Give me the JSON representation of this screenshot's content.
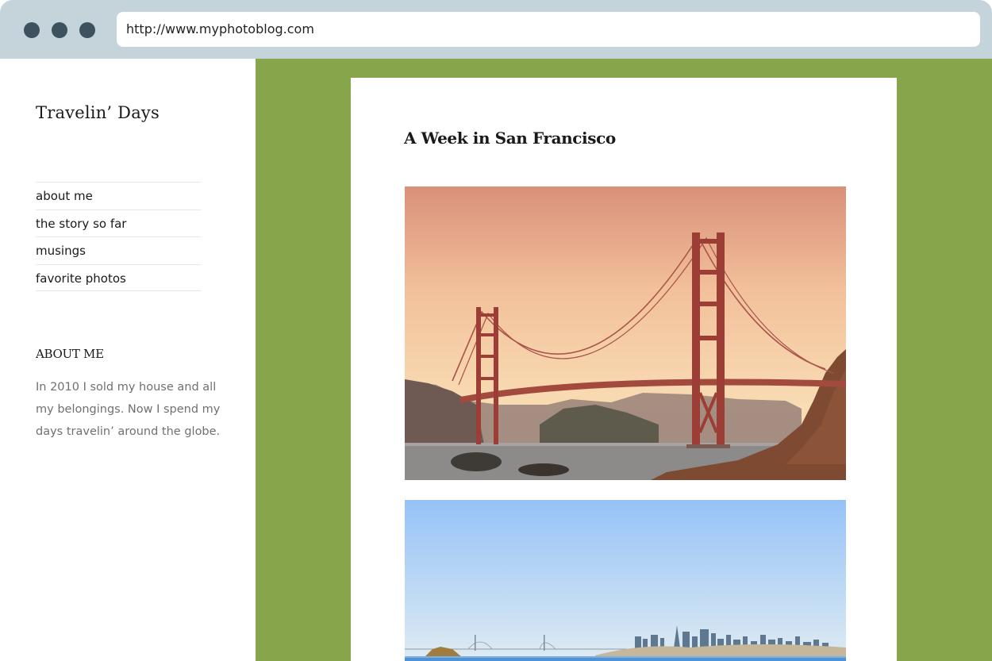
{
  "browser": {
    "url": "http://www.myphotoblog.com",
    "window_controls": [
      "dot-icon",
      "dot-icon",
      "dot-icon"
    ]
  },
  "sidebar": {
    "site_title": "Travelin’ Days",
    "nav": [
      {
        "label": "about me"
      },
      {
        "label": "the story so far"
      },
      {
        "label": "musings"
      },
      {
        "label": "favorite photos"
      }
    ],
    "widget": {
      "title": "ABOUT ME",
      "text": "In 2010 I sold my house and all my belongings. Now I spend my days travelin’ around the globe."
    }
  },
  "post": {
    "title": "A Week in San Francisco",
    "photos": [
      {
        "subject": "Golden Gate Bridge at sunset"
      },
      {
        "subject": "San Francisco skyline across the bay"
      }
    ]
  },
  "colors": {
    "accent_green": "#87a54b",
    "browser_bar": "#c5d4db",
    "window_dot": "#3c535f"
  }
}
